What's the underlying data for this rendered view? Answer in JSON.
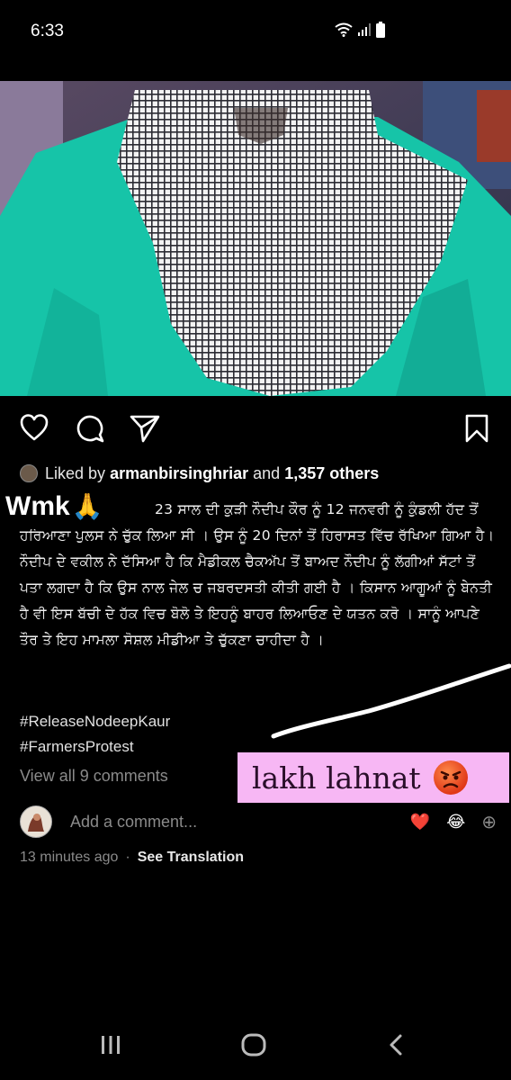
{
  "status_bar": {
    "time": "6:33"
  },
  "post": {
    "liked_prefix": "Liked by",
    "liked_user": "armanbirsinghriar",
    "liked_and": "and",
    "liked_count": "1,357 others",
    "caption": "23 ਸਾਲ ਦੀ ਕੁੜੀ ਨੌਦੀਪ ਕੌਰ ਨੂੰ 12 ਜਨਵਰੀ ਨੂੰ ਕੁੰਡਲੀ ਹੱਦ ਤੋਂ ਹਰਿਆਣਾ ਪੁਲਸ ਨੇ ਚੁੱਕ ਲਿਆ ਸੀ । ਉਸ ਨੂੰ 20 ਦਿਨਾਂ ਤੋਂ ਹਿਰਾਸਤ ਵਿੱਚ ਰੱਖਿਆ ਗਿਆ ਹੈ। ਨੌਦੀਪ ਦੇ ਵਕੀਲ ਨੇ ਦੱਸਿਆ ਹੈ ਕਿ ਮੈਡੀਕਲ ਚੈਕਅੱਪ ਤੋਂ ਬਾਅਦ ਨੌਦੀਪ ਨੂੰ ਲੱਗੀਆਂ ਸੱਟਾਂ ਤੋਂ ਪਤਾ ਲਗਦਾ ਹੈ ਕਿ ਉਸ ਨਾਲ ਜੇਲ ਚ ਜਬਰਦਸਤੀ ਕੀਤੀ ਗਈ ਹੈ । ਕਿਸਾਨ ਆਗੂਆਂ ਨੂੰ ਬੇਨਤੀ ਹੈ ਵੀ ਇਸ ਬੱਚੀ ਦੇ ਹੱਕ ਵਿਚ ਬੋਲੋ ਤੇ ਇਹਨੂੰ ਬਾਹਰ ਲਿਆਓਣ ਦੇ ਯਤਨ ਕਰੋ । ਸਾਨੂੰ ਆਪਣੇ ਤੌਰ ਤੇ ਇਹ ਮਾਮਲਾ ਸੋਸ਼ਲ ਮੀਡੀਆ ਤੇ ਚੁੱਕਣਾ ਚਾਹੀਦਾ ਹੈ ।",
    "hashtags": [
      "#ReleaseNodeepKaur",
      "#FarmersProtest"
    ],
    "view_comments": "View all 9 comments",
    "add_comment_placeholder": "Add a comment...",
    "quick_emojis": [
      "❤️",
      "😂",
      "⊕"
    ],
    "timestamp": "13 minutes ago",
    "separator": "·",
    "see_translation": "See Translation"
  },
  "story_overlay": {
    "wmk_text": "Wmk",
    "wmk_emoji": "🙏",
    "sticker_text": "lakh lahnat",
    "sticker_color": "#f7b7f4"
  },
  "icons": {
    "like": "heart-icon",
    "comment": "comment-icon",
    "share": "send-icon",
    "save": "bookmark-icon",
    "nav_recent": "recent-apps-icon",
    "nav_home": "home-icon",
    "nav_back": "back-icon"
  }
}
